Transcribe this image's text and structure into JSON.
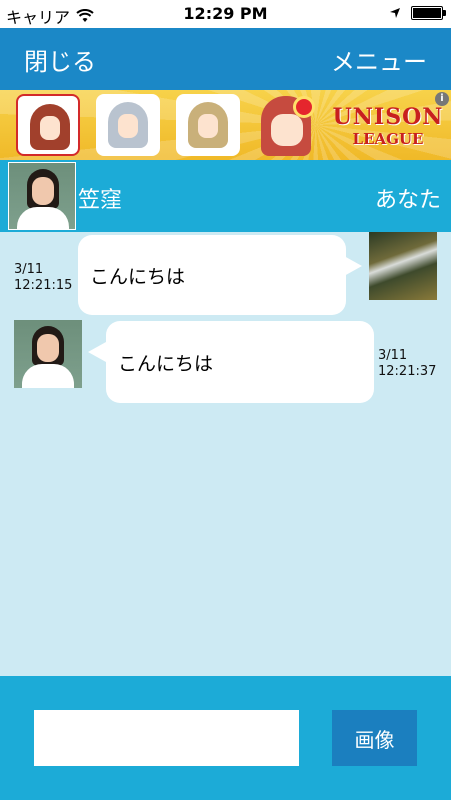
{
  "status_bar": {
    "carrier": "キャリア",
    "time": "12:29 PM",
    "battery_level": 1.0
  },
  "nav": {
    "close_label": "閉じる",
    "menu_label": "メニュー"
  },
  "ad": {
    "logo_line1": "UNISON",
    "logo_line2": "LEAGUE",
    "info_symbol": "i"
  },
  "chat_header": {
    "partner_name": "笠窪",
    "self_label": "あなた"
  },
  "messages": [
    {
      "sender": "self",
      "text": "こんにちは",
      "date": "3/11",
      "time": "12:21:15"
    },
    {
      "sender": "partner",
      "text": "こんにちは",
      "date": "3/11",
      "time": "12:21:37"
    }
  ],
  "composer": {
    "input_value": "",
    "image_button_label": "画像"
  },
  "colors": {
    "nav_bg": "#1b88c7",
    "header_bg": "#1cabd7",
    "chat_bg": "#cdeaf3",
    "button_bg": "#1b7fbf"
  }
}
